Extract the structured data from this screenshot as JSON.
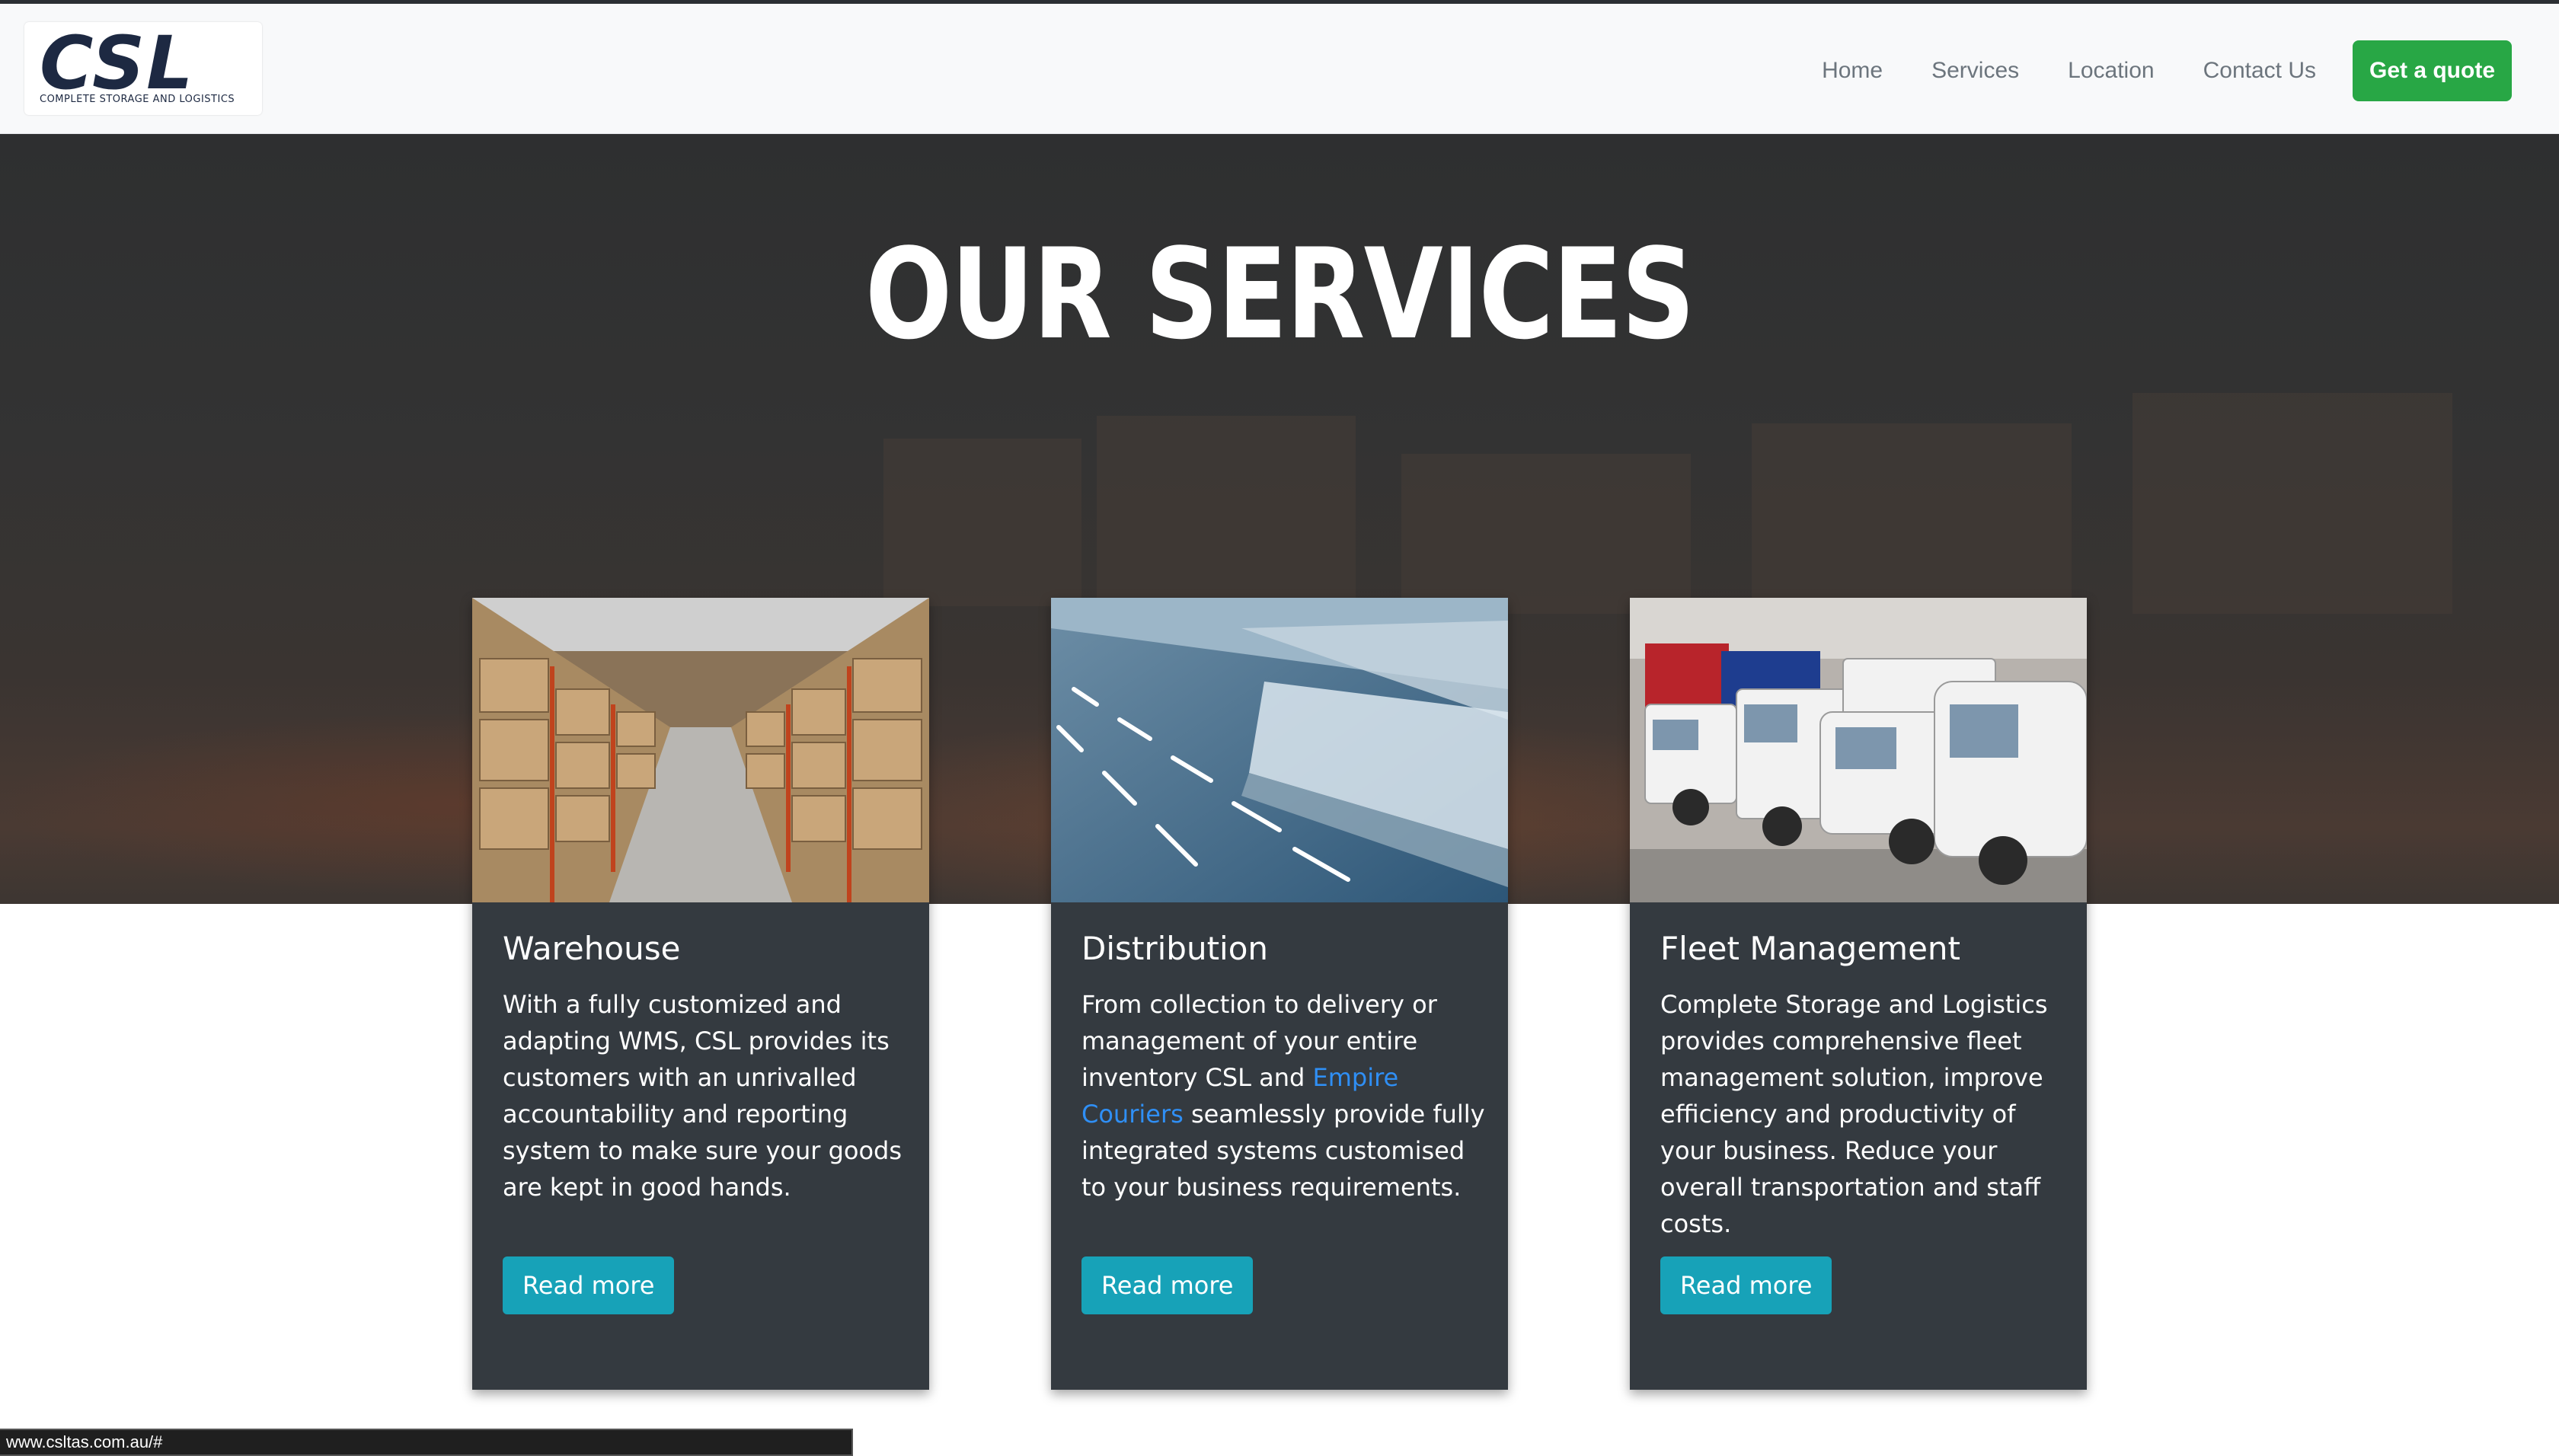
{
  "header": {
    "logo_text": "CSL",
    "logo_tagline": "COMPLETE STORAGE AND LOGISTICS",
    "nav": [
      "Home",
      "Services",
      "Location",
      "Contact Us"
    ],
    "cta_label": "Get a quote"
  },
  "hero": {
    "title": "OUR SERVICES"
  },
  "cards": [
    {
      "title": "Warehouse",
      "text": "With a fully customized and adapting WMS, CSL provides its customers with an unrivalled accountability and reporting system to make sure your goods are kept in good hands.",
      "button": "Read more",
      "image": "warehouse-aisle-image"
    },
    {
      "title": "Distribution",
      "text_before": "From collection to delivery or management of your entire inventory CSL and ",
      "link_text": "Empire Couriers",
      "text_after": " seamlessly provide fully integrated systems customised to your business requirements.",
      "button": "Read more",
      "image": "highway-truck-image"
    },
    {
      "title": "Fleet Management",
      "text": "Complete Storage and Logistics provides comprehensive fleet management solution, improve efficiency and productivity of your business. Reduce your overall transportation and staff costs.",
      "button": "Read more",
      "image": "fleet-vans-image"
    }
  ],
  "status_url": "www.csltas.com.au/#",
  "colors": {
    "primary_green": "#28a745",
    "card_bg": "#343a40",
    "read_more": "#17a2b8",
    "link_blue": "#2f8ff5"
  }
}
